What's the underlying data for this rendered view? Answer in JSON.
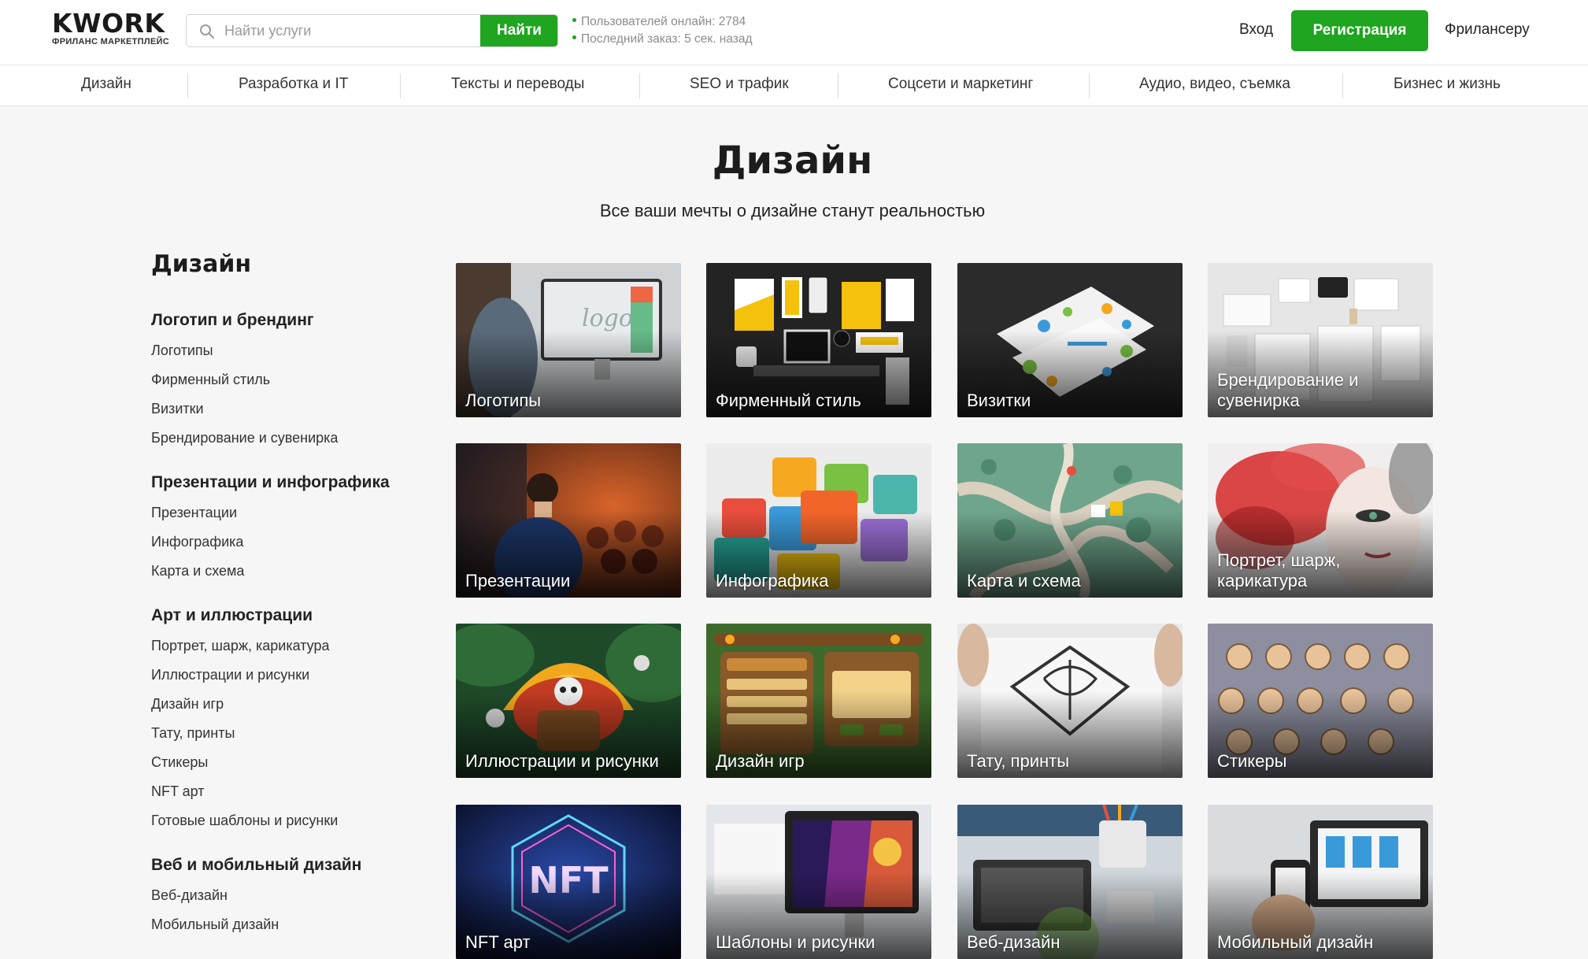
{
  "header": {
    "logo_text": "KWORK",
    "logo_subtitle": "ФРИЛАНС МАРКЕТПЛЕЙС",
    "search_placeholder": "Найти услуги",
    "search_button": "Найти",
    "stats_online": "Пользователей онлайн: 2784",
    "stats_last_order": "Последний заказ: 5 сек. назад",
    "login": "Вход",
    "register": "Регистрация",
    "freelancer": "Фрилансеру",
    "accent_color": "#1fa51f"
  },
  "catnav": {
    "items": [
      "Дизайн",
      "Разработка и IT",
      "Тексты и переводы",
      "SEO и трафик",
      "Соцсети и маркетинг",
      "Аудио, видео, съемка",
      "Бизнес и жизнь"
    ]
  },
  "hero": {
    "title": "Дизайн",
    "subtitle": "Все ваши мечты о дизайне станут реальностью"
  },
  "sidebar": {
    "title": "Дизайн",
    "groups": [
      {
        "title": "Логотип и брендинг",
        "items": [
          "Логотипы",
          "Фирменный стиль",
          "Визитки",
          "Брендирование и сувенирка"
        ]
      },
      {
        "title": "Презентации и инфографика",
        "items": [
          "Презентации",
          "Инфографика",
          "Карта и схема"
        ]
      },
      {
        "title": "Арт и иллюстрации",
        "items": [
          "Портрет, шарж, карикатура",
          "Иллюстрации и рисунки",
          "Дизайн игр",
          "Тату, принты",
          "Стикеры",
          "NFT арт",
          "Готовые шаблоны и рисунки"
        ]
      },
      {
        "title": "Веб и мобильный дизайн",
        "items": [
          "Веб-дизайн",
          "Мобильный дизайн"
        ]
      }
    ]
  },
  "tiles": [
    {
      "label": "Логотипы",
      "icon": "logo-monitor"
    },
    {
      "label": "Фирменный стиль",
      "icon": "brand-identity"
    },
    {
      "label": "Визитки",
      "icon": "business-cards"
    },
    {
      "label": "Брендирование и сувенирка",
      "icon": "branded-stationery"
    },
    {
      "label": "Презентации",
      "icon": "speaker-audience"
    },
    {
      "label": "Инфографика",
      "icon": "infographic-cards"
    },
    {
      "label": "Карта и схема",
      "icon": "flat-map"
    },
    {
      "label": "Портрет, шарж, карикатура",
      "icon": "watercolor-portrait"
    },
    {
      "label": "Иллюстрации и рисунки",
      "icon": "jungle-skull"
    },
    {
      "label": "Дизайн игр",
      "icon": "game-ui"
    },
    {
      "label": "Тату, принты",
      "icon": "tattoo-sketch"
    },
    {
      "label": "Стикеры",
      "icon": "dog-stickers"
    },
    {
      "label": "NFT арт",
      "icon": "nft-neon"
    },
    {
      "label": "Шаблоны и рисунки",
      "icon": "monitor-templates"
    },
    {
      "label": "Веб-дизайн",
      "icon": "designer-desk"
    },
    {
      "label": "Мобильный дизайн",
      "icon": "phone-laptop"
    }
  ]
}
